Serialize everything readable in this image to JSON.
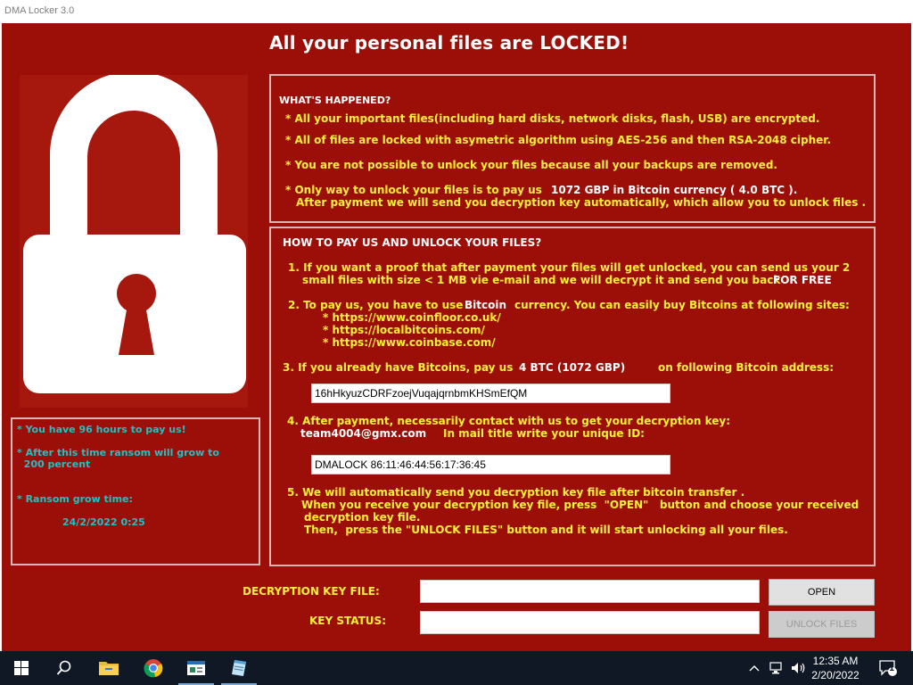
{
  "window": {
    "title": "DMA Locker 3.0"
  },
  "headline": "All your personal files are LOCKED!",
  "info_panel": {
    "line1": "* You have 96 hours to pay us!",
    "line2a": "* After this time ransom will grow to",
    "line2b": "  200 percent",
    "line3": "* Ransom grow time:",
    "grow_time": "24/2/2022 0:25"
  },
  "whats_happened": {
    "heading": "WHAT'S HAPPENED?",
    "items": [
      "* All your important files(including hard disks, network disks, flash, USB) are encrypted.",
      "* All of files are locked with asymetric algorithm using AES-256 and then RSA-2048 cipher.",
      "* You are not possible to unlock your files because all your backups are removed."
    ],
    "item4_prefix": "* Only way to unlock your files is to pay us",
    "item4_amount": "1072 GBP in Bitcoin currency ( 4.0 BTC ).",
    "item4_line2": "After payment we will send you decryption key automatically, which allow you to unlock files ."
  },
  "how_to_pay": {
    "heading": "HOW TO PAY US AND UNLOCK YOUR FILES?",
    "step1_line1": "1. If you want a proof that after payment your files will get unlocked, you can send us your 2",
    "step1_line2": "small files with size < 1 MB vie e-mail and we will decrypt it and send you back",
    "step1_free": "FOR FREE",
    "step2_prefix": "2. To pay us, you have to use",
    "step2_currency": "Bitcoin",
    "step2_suffix": "currency. You can easily buy Bitcoins at following sites:",
    "sites": [
      "* https://www.coinfloor.co.uk/",
      "* https://localbitcoins.com/",
      "* https://www.coinbase.com/"
    ],
    "step3_prefix": "3. If you already have Bitcoins, pay us",
    "step3_amount": "4 BTC (1072 GBP)",
    "step3_suffix": "on following Bitcoin address:",
    "bitcoin_address": "16hHkyuzCDRFzoejVuqajqrnbmKHSmEfQM",
    "step4_line1": "4. After payment, necessarily contact with us to get your decryption key:",
    "email": "team4004@gmx.com",
    "step4_title_note": "In mail title write your unique ID:",
    "unique_id": "DMALOCK 86:11:46:44:56:17:36:45",
    "step5_line1": "5. We will automatically send you decryption key file after bitcoin transfer .",
    "step5_line2": "When you receive your decryption key file, press  \"OPEN\"   button and choose your received",
    "step5_line3": "decryption key file.",
    "step5_line4": "Then,  press the \"UNLOCK FILES\" button and it will start unlocking all your files."
  },
  "controls": {
    "key_file_label": "DECRYPTION KEY FILE:",
    "key_file_value": "",
    "open_button": "OPEN",
    "status_label": "KEY STATUS:",
    "status_value": "",
    "unlock_button": "UNLOCK FILES"
  },
  "taskbar": {
    "icons": [
      "windows-start-icon",
      "search-icon",
      "file-explorer-icon",
      "chrome-icon",
      "app-window-icon",
      "notepad-icon"
    ],
    "time": "12:35 AM",
    "date": "2/20/2022",
    "notification_count": "1"
  },
  "colors": {
    "background": "#9c0f08",
    "text_yellow": "#ffef3c",
    "text_teal": "#1ec2c5"
  }
}
